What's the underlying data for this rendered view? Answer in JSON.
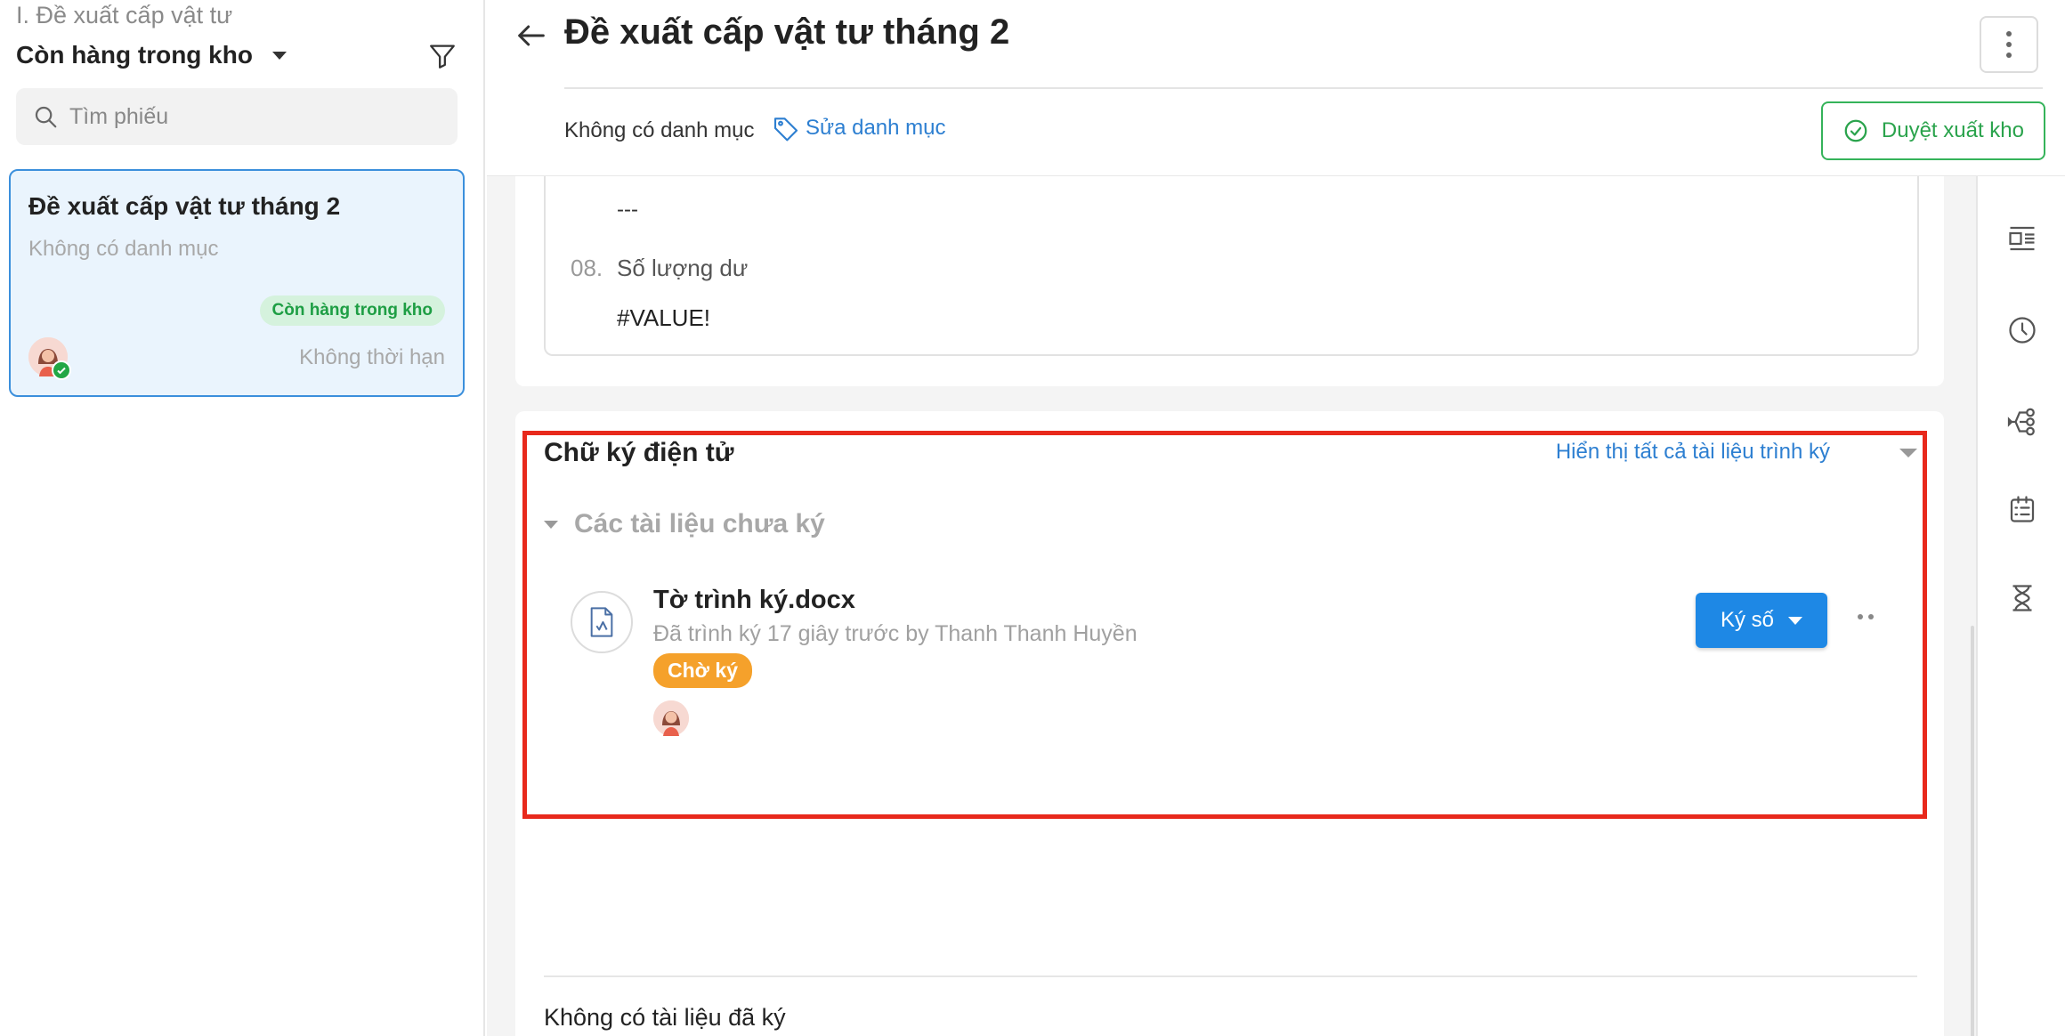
{
  "sidebar": {
    "breadcrumb": "I. Đề xuất cấp vật tư",
    "status_filter": "Còn hàng trong kho",
    "search_placeholder": "Tìm phiếu",
    "card": {
      "title": "Đề xuất cấp vật tư tháng 2",
      "category": "Không có danh mục",
      "badge": "Còn hàng trong kho",
      "deadline": "Không thời hạn"
    }
  },
  "header": {
    "title": "Đề xuất cấp vật tư tháng 2",
    "category": "Không có danh mục",
    "edit_category": "Sửa danh mục",
    "approve_button": "Duyệt xuất kho"
  },
  "fields": {
    "prev_value": "---",
    "number": "08.",
    "label": "Số lượng dư",
    "value": "#VALUE!"
  },
  "signature": {
    "title": "Chữ ký điện tử",
    "show_all": "Hiển thị tất cả tài liệu trình ký",
    "unsigned_group": "Các tài liệu chưa ký",
    "document": {
      "name": "Tờ trình ký.docx",
      "meta": "Đã trình ký 17 giây trước by Thanh Thanh Huyền",
      "status": "Chờ ký",
      "sign_button": "Ký số"
    },
    "signed_empty": "Không có tài liệu đã ký"
  },
  "colors": {
    "primary": "#1e88e5",
    "success": "#2aa34c",
    "warning": "#f5a12b",
    "highlight": "#e8291c"
  },
  "icons": [
    "filter-icon",
    "search-icon",
    "back-arrow-icon",
    "more-vertical-icon",
    "tag-icon",
    "check-circle-icon",
    "layout-icon",
    "clock-icon",
    "share-icon",
    "checklist-icon",
    "hourglass-icon",
    "document-icon"
  ]
}
